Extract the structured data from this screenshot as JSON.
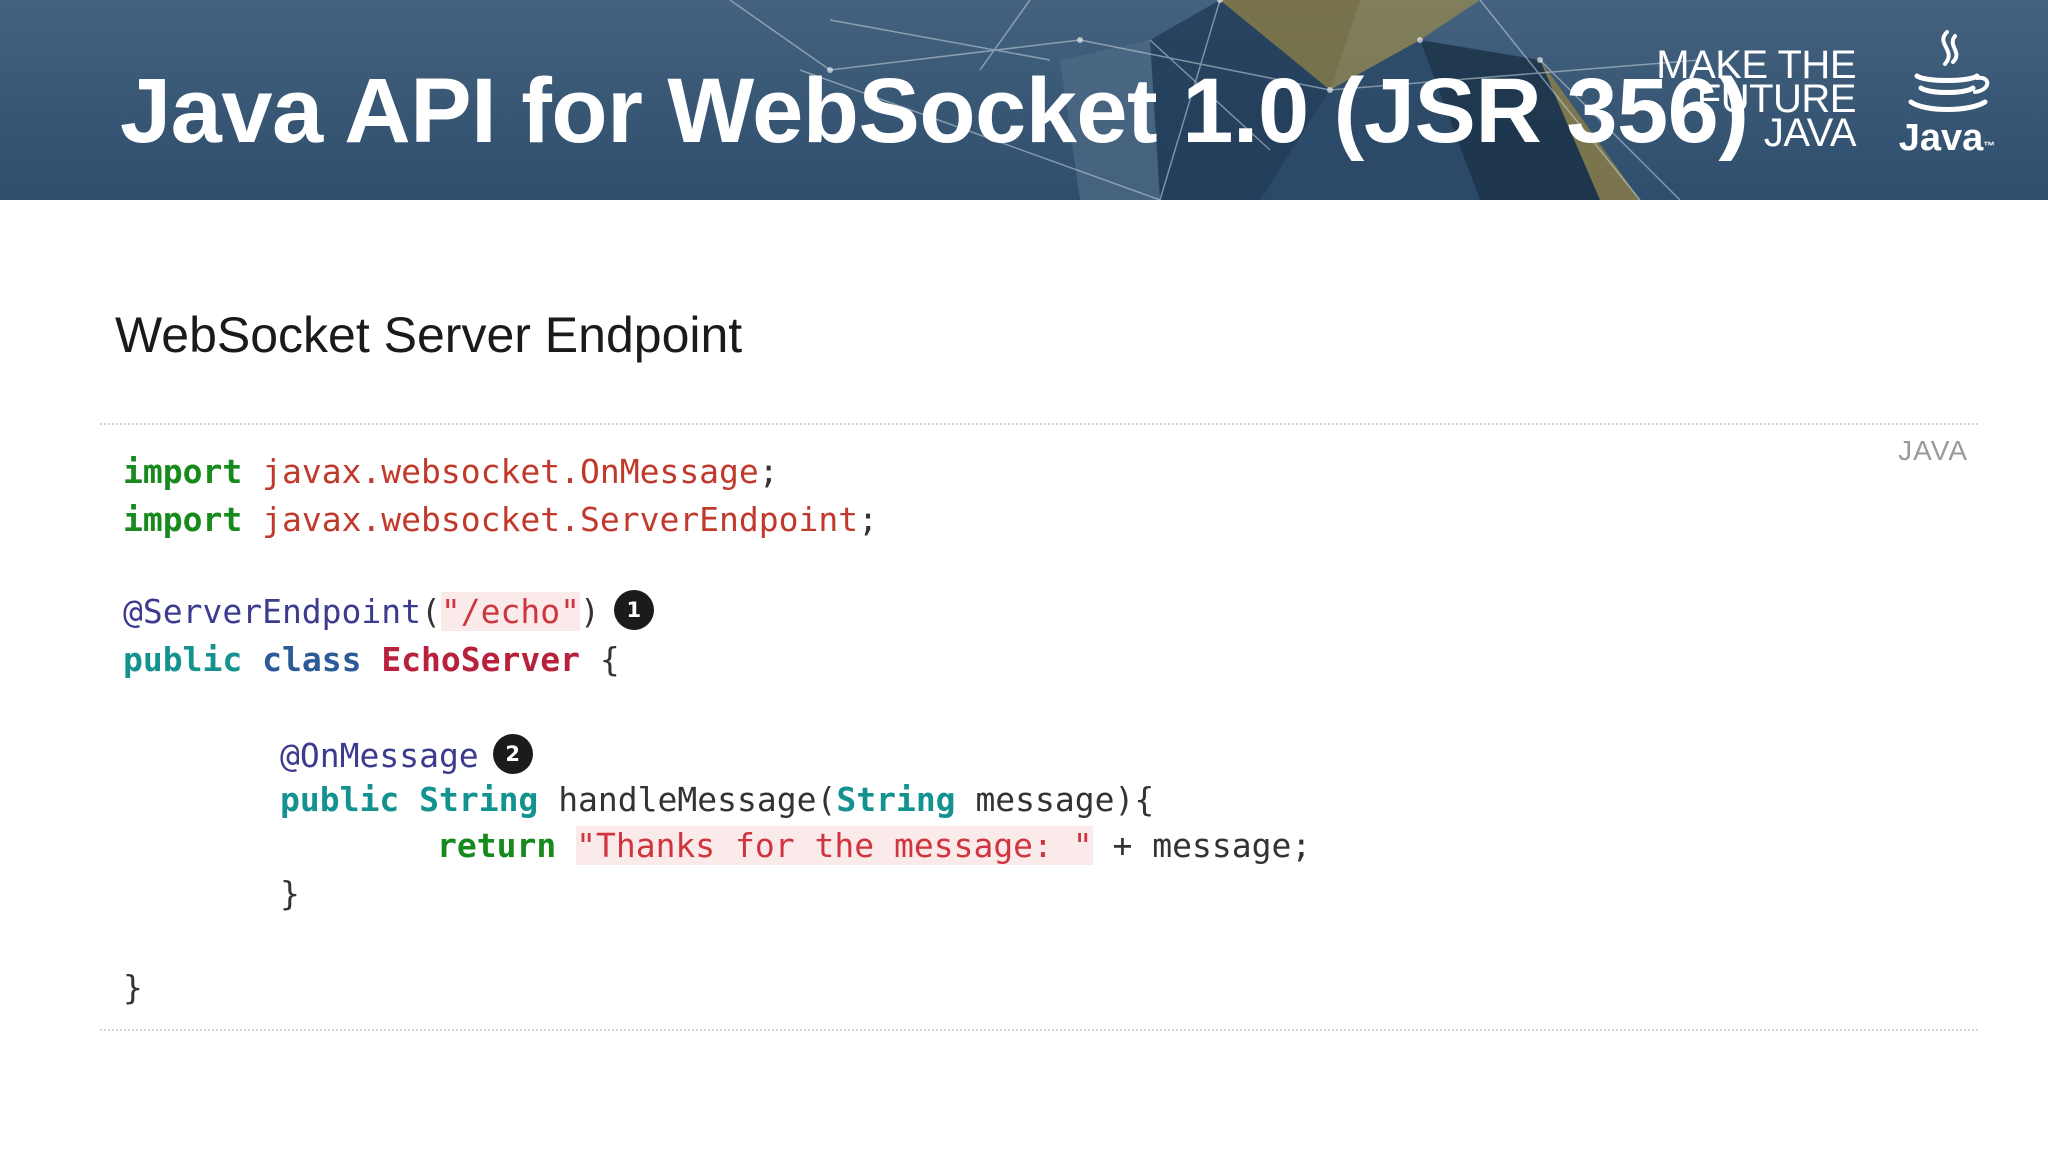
{
  "header": {
    "title": "Java API for WebSocket 1.0 (JSR 356)",
    "tagline": [
      "MAKE THE",
      "FUTURE",
      "JAVA"
    ],
    "logo_text": "Java",
    "logo_tm": "™",
    "logo_icon": "java-coffee-cup-icon"
  },
  "section": {
    "heading": "WebSocket Server Endpoint"
  },
  "code": {
    "language": "JAVA",
    "line1": {
      "kw": "import",
      "pkg": "javax.websocket.OnMessage",
      "end": ";"
    },
    "line2": {
      "kw": "import",
      "pkg": "javax.websocket.ServerEndpoint",
      "end": ";"
    },
    "line3": {
      "annot": "@ServerEndpoint",
      "open": "(",
      "str": "\"/echo\"",
      "close": ")",
      "callout": "1"
    },
    "line4": {
      "kw1": "public",
      "kw2": "class",
      "cls": "EchoServer",
      "brace": "{"
    },
    "line5": {
      "annot": "@OnMessage",
      "callout": "2"
    },
    "line6": {
      "kw1": "public",
      "type1": "String",
      "method": "handleMessage(",
      "type2": "String",
      "rest": "message){"
    },
    "line7": {
      "kw": "return",
      "str": "\"Thanks for the message: \"",
      "rest": "+ message;"
    },
    "line8": {
      "brace": "}"
    },
    "line9": {
      "brace": "}"
    }
  },
  "colors": {
    "banner": "#3a5977",
    "keyword_green": "#178a1e",
    "keyword_teal": "#13928f",
    "string_red": "#d0353f"
  }
}
